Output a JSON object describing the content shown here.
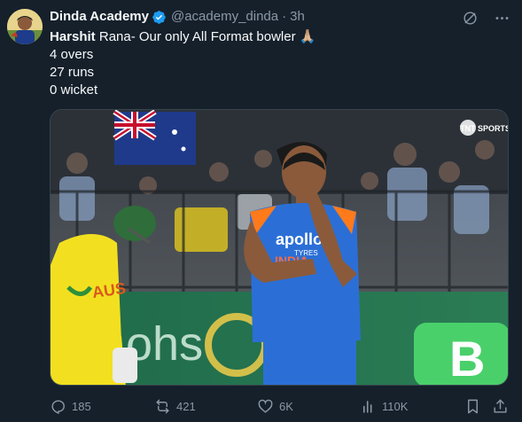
{
  "author": {
    "name": "Dinda Academy",
    "handle": "@academy_dinda",
    "separator": "·",
    "time": "3h"
  },
  "post": {
    "line1_bold": "Harshit",
    "line1_rest": " Rana- Our only All Format bowler 🙏🏼",
    "line2": "4 overs",
    "line3": "27 runs",
    "line4": "0 wicket"
  },
  "media": {
    "jersey_sponsor": "apollo",
    "jersey_sub": "TYRES",
    "jersey_country": "INDIA",
    "jersey_aus": "AUS",
    "broadcaster": "TNT SPORTS",
    "board_text": "ohs",
    "board_letter": "B"
  },
  "stats": {
    "replies": "185",
    "reposts": "421",
    "likes": "6K",
    "views": "110K"
  },
  "icons": {
    "verified": "verified-badge-icon",
    "grok": "grok-icon",
    "more": "more-icon",
    "reply": "reply-icon",
    "repost": "repost-icon",
    "like": "like-icon",
    "views": "views-icon",
    "bookmark": "bookmark-icon",
    "share": "share-icon"
  },
  "colors": {
    "background": "#15202b",
    "secondary_text": "#8b98a5",
    "verified": "#1d9bf0"
  }
}
